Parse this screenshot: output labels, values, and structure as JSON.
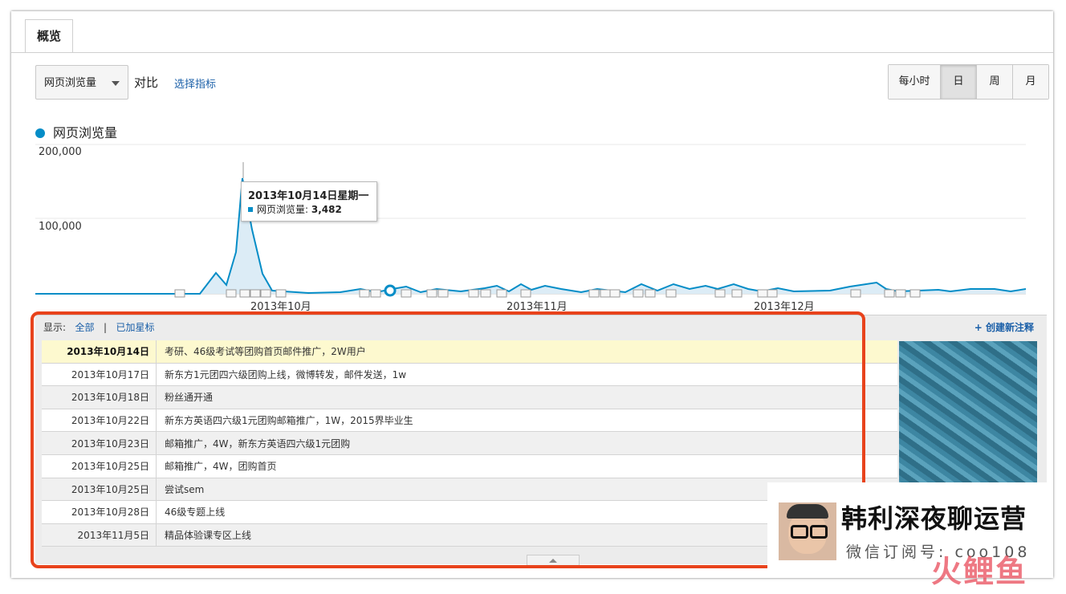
{
  "tab": "概览",
  "metric_select": "网页浏览量",
  "compare_label": "对比",
  "choose_metric": "选择指标",
  "granularity": [
    {
      "label": "每小时",
      "active": false
    },
    {
      "label": "日",
      "active": true
    },
    {
      "label": "周",
      "active": false
    },
    {
      "label": "月",
      "active": false
    }
  ],
  "chart_data": {
    "type": "area",
    "series": [
      {
        "name": "网页浏览量",
        "color": "#058dc7"
      }
    ],
    "y_ticks": [
      "200,000",
      "100,000"
    ],
    "ylim": [
      0,
      200000
    ],
    "x_labels": [
      "2013年10月",
      "2013年11月",
      "2013年12月"
    ],
    "tooltip": {
      "date": "2013年10月14日星期一",
      "metric": "网页浏览量",
      "value": "3,482"
    }
  },
  "annotations": {
    "show_label": "显示:",
    "filter_all": "全部",
    "separator": "|",
    "filter_starred": "已加星标",
    "create_note": "+ 创建新注释",
    "rows": [
      {
        "date": "2013年10月14日",
        "text": "考研、46级考试等团购首页邮件推广，2W用户"
      },
      {
        "date": "2013年10月17日",
        "text": "新东方1元团四六级团购上线，微博转发，邮件发送，1w"
      },
      {
        "date": "2013年10月18日",
        "text": "粉丝通开通"
      },
      {
        "date": "2013年10月22日",
        "text": "新东方英语四六级1元团购邮箱推广，1W，2015界毕业生"
      },
      {
        "date": "2013年10月23日",
        "text": "邮箱推广，4W，新东方英语四六级1元团购"
      },
      {
        "date": "2013年10月25日",
        "text": "邮箱推广，4W，团购首页"
      },
      {
        "date": "2013年10月25日",
        "text": "尝试sem"
      },
      {
        "date": "2013年10月28日",
        "text": "46级专题上线"
      },
      {
        "date": "2013年11月5日",
        "text": "精品体验课专区上线"
      }
    ]
  },
  "brand": {
    "title": "韩利深夜聊运营",
    "subtitle": "微信订阅号: coo108"
  },
  "watermark": "火鲤鱼"
}
